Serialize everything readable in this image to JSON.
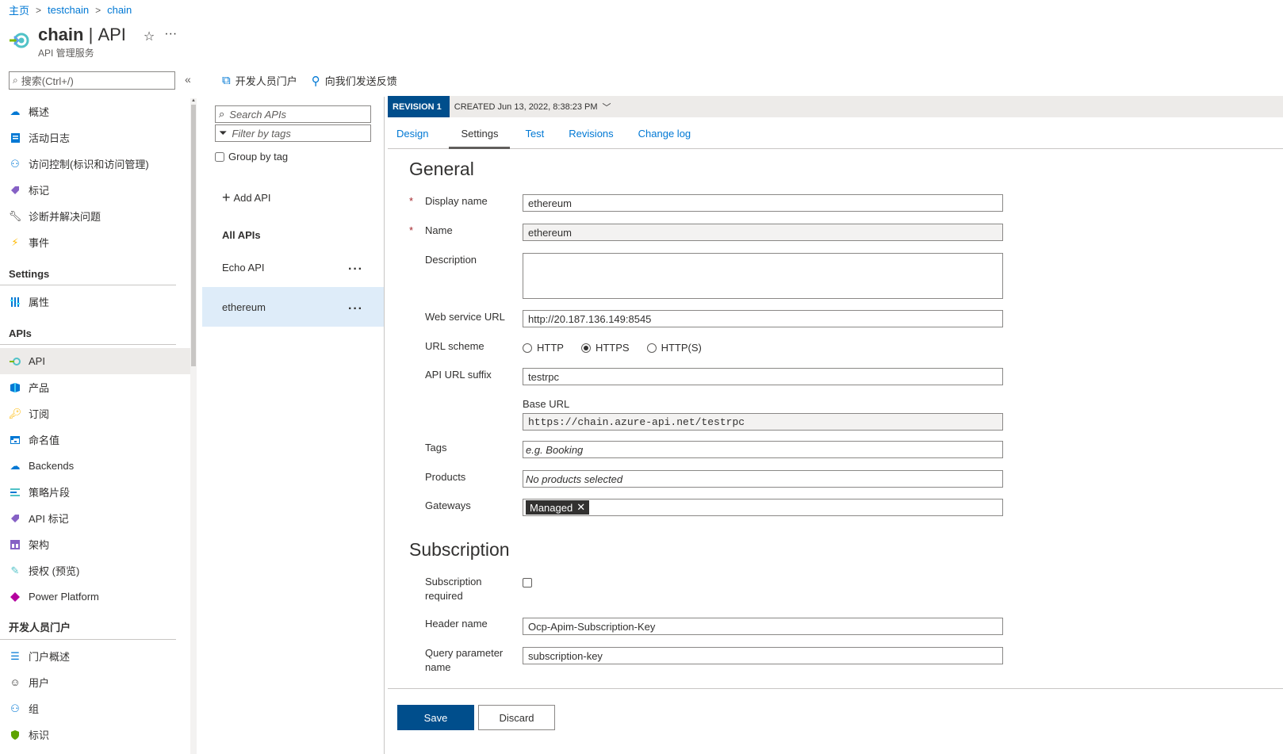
{
  "breadcrumb": {
    "items": [
      "主页",
      "testchain",
      "chain"
    ]
  },
  "header": {
    "title_main": "chain",
    "title_sep": "|",
    "title_sub": "API",
    "subtitle": "API 管理服务"
  },
  "nav": {
    "search_placeholder": "搜索(Ctrl+/)",
    "top_items": [
      {
        "label": "概述",
        "icon": "cloud-icon"
      },
      {
        "label": "活动日志",
        "icon": "log-icon"
      },
      {
        "label": "访问控制(标识和访问管理)",
        "icon": "people-icon"
      },
      {
        "label": "标记",
        "icon": "tag-icon"
      },
      {
        "label": "诊断并解决问题",
        "icon": "wrench-icon"
      },
      {
        "label": "事件",
        "icon": "lightning-icon"
      }
    ],
    "settings_header": "Settings",
    "settings_items": [
      {
        "label": "属性",
        "icon": "properties-icon"
      }
    ],
    "apis_header": "APIs",
    "apis_items": [
      {
        "label": "API",
        "icon": "api-icon",
        "active": true
      },
      {
        "label": "产品",
        "icon": "product-icon"
      },
      {
        "label": "订阅",
        "icon": "key-icon"
      },
      {
        "label": "命名值",
        "icon": "table-icon"
      },
      {
        "label": "Backends",
        "icon": "cloud-backend-icon"
      },
      {
        "label": "策略片段",
        "icon": "fragment-icon"
      },
      {
        "label": "API 标记",
        "icon": "tag-icon"
      },
      {
        "label": "架构",
        "icon": "schema-icon"
      },
      {
        "label": "授权 (预览)",
        "icon": "authorization-icon"
      },
      {
        "label": "Power Platform",
        "icon": "power-platform-icon"
      }
    ],
    "portal_header": "开发人员门户",
    "portal_items": [
      {
        "label": "门户概述",
        "icon": "list-icon"
      },
      {
        "label": "用户",
        "icon": "user-icon"
      },
      {
        "label": "组",
        "icon": "group-icon"
      },
      {
        "label": "标识",
        "icon": "shield-icon"
      }
    ]
  },
  "toolbar": {
    "developer_portal": "开发人员门户",
    "feedback": "向我们发送反馈"
  },
  "apis": {
    "search_placeholder": "Search APIs",
    "filter_placeholder": "Filter by tags",
    "group_by_tag": "Group by tag",
    "add_api": "Add API",
    "all_apis": "All APIs",
    "list": [
      {
        "name": "Echo API",
        "selected": false
      },
      {
        "name": "ethereum",
        "selected": true
      }
    ]
  },
  "revision": {
    "badge": "REVISION 1",
    "created": "CREATED Jun 13, 2022, 8:38:23 PM"
  },
  "tabs": [
    "Design",
    "Settings",
    "Test",
    "Revisions",
    "Change log"
  ],
  "active_tab": "Settings",
  "general": {
    "title": "General",
    "display_name_label": "Display name",
    "display_name": "ethereum",
    "name_label": "Name",
    "name": "ethereum",
    "description_label": "Description",
    "description": "",
    "web_service_url_label": "Web service URL",
    "web_service_url": "http://20.187.136.149:8545",
    "url_scheme_label": "URL scheme",
    "url_scheme_options": [
      "HTTP",
      "HTTPS",
      "HTTP(S)"
    ],
    "url_scheme_selected": "HTTPS",
    "api_url_suffix_label": "API URL suffix",
    "api_url_suffix": "testrpc",
    "base_url_label": "Base URL",
    "base_url": "https://chain.azure-api.net/testrpc",
    "tags_label": "Tags",
    "tags_placeholder": "e.g. Booking",
    "products_label": "Products",
    "products_placeholder": "No products selected",
    "gateways_label": "Gateways",
    "gateway_chip": "Managed"
  },
  "subscription": {
    "title": "Subscription",
    "required_label_1": "Subscription",
    "required_label_2": "required",
    "required": false,
    "header_name_label": "Header name",
    "header_name": "Ocp-Apim-Subscription-Key",
    "query_param_label_1": "Query parameter",
    "query_param_label_2": "name",
    "query_param": "subscription-key"
  },
  "buttons": {
    "save": "Save",
    "discard": "Discard"
  },
  "colors": {
    "accent": "#0078d4",
    "primary_button": "#004e8c",
    "selected_row": "#deecf9"
  }
}
